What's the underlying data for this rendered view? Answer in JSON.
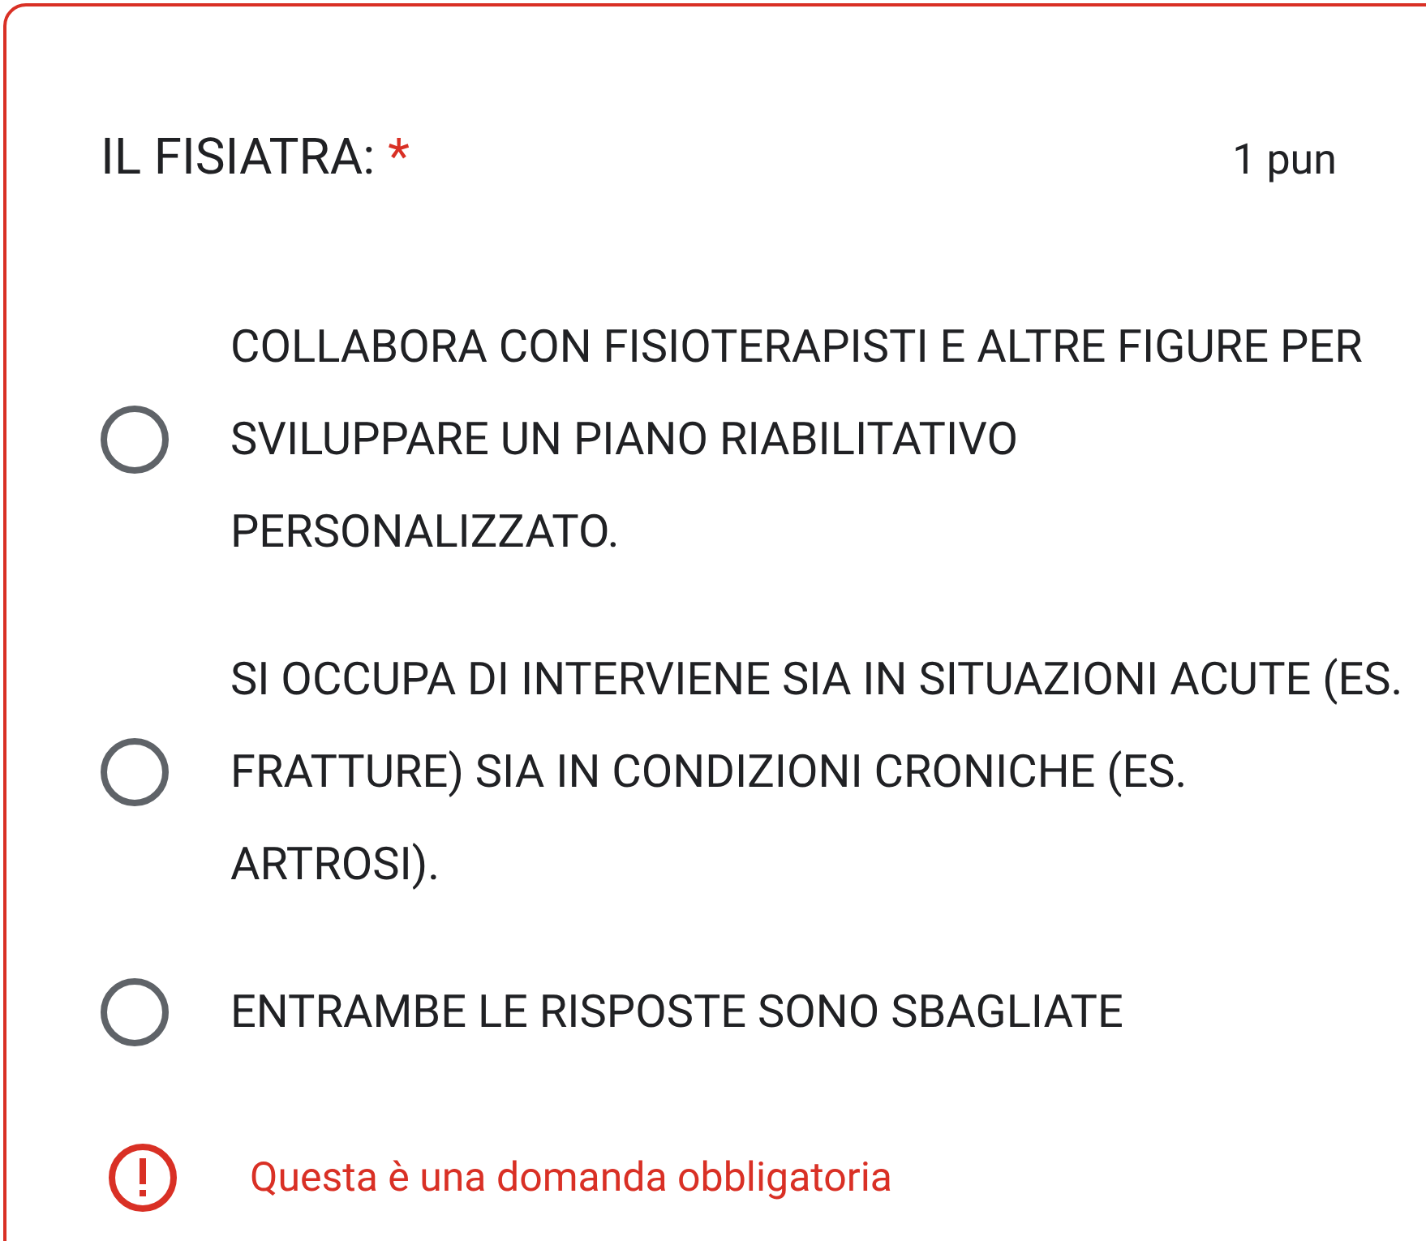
{
  "question": {
    "title": "IL FISIATRA:",
    "required": true,
    "points": "1 pun"
  },
  "options": [
    {
      "label": "COLLABORA CON FISIOTERAPISTI E ALTRE FIGURE PER SVILUPPARE UN PIANO RIABILITATIVO PERSONALIZZATO.",
      "selected": false
    },
    {
      "label": "SI OCCUPA DI INTERVIENE SIA IN SITUAZIONI ACUTE (ES. FRATTURE) SIA IN CONDIZIONI CRONICHE (ES. ARTROSI).",
      "selected": false
    },
    {
      "label": "ENTRAMBE LE RISPOSTE SONO SBAGLIATE",
      "selected": false
    }
  ],
  "error": "Questa è una domanda obbligatoria",
  "asterisk": "*"
}
